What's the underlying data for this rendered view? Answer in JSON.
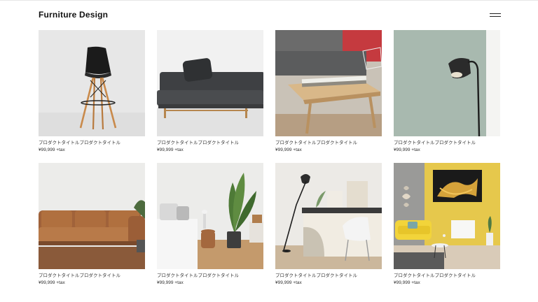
{
  "site": {
    "title": "Furniture Design"
  },
  "products": [
    {
      "title": "プロダクトタイトルプロダクトタイトル",
      "price": "¥99,999 +tax",
      "image": "chair"
    },
    {
      "title": "プロダクトタイトルプロダクトタイトル",
      "price": "¥99,999 +tax",
      "image": "sofa-gray"
    },
    {
      "title": "プロダクトタイトルプロダクトタイトル",
      "price": "¥99,999 +tax",
      "image": "wood-table"
    },
    {
      "title": "プロダクトタイトルプロダクトタイトル",
      "price": "¥99,999 +tax",
      "image": "floor-lamp"
    },
    {
      "title": "プロダクトタイトルプロダクトタイトル",
      "price": "¥99,999 +tax",
      "image": "leather-sofa"
    },
    {
      "title": "プロダクトタイトルプロダクトタイトル",
      "price": "¥99,999 +tax",
      "image": "bedroom"
    },
    {
      "title": "プロダクトタイトルプロダクトタイトル",
      "price": "¥99,999 +tax",
      "image": "desk"
    },
    {
      "title": "プロダクトタイトルプロダクトタイトル",
      "price": "¥99,999 +tax",
      "image": "yellow-room"
    }
  ]
}
